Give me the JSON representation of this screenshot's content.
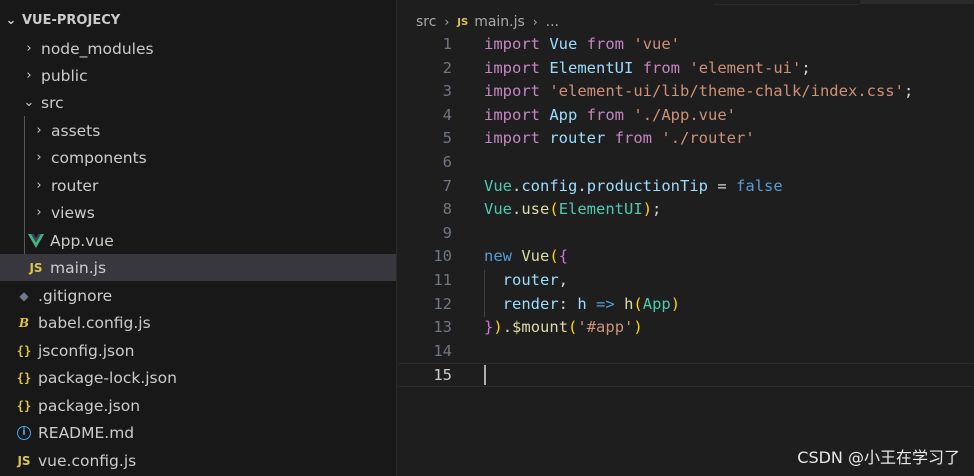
{
  "explorer": {
    "project_name": "VUE-PROJECY",
    "items": [
      {
        "label": "node_modules",
        "kind": "folder",
        "expanded": false
      },
      {
        "label": "public",
        "kind": "folder",
        "expanded": false
      },
      {
        "label": "src",
        "kind": "folder",
        "expanded": true
      },
      {
        "label": "assets",
        "kind": "folder",
        "expanded": false
      },
      {
        "label": "components",
        "kind": "folder",
        "expanded": false
      },
      {
        "label": "router",
        "kind": "folder",
        "expanded": false
      },
      {
        "label": "views",
        "kind": "folder",
        "expanded": false
      },
      {
        "label": "App.vue",
        "kind": "vue-file"
      },
      {
        "label": "main.js",
        "kind": "js-file",
        "selected": true
      },
      {
        "label": ".gitignore",
        "kind": "git-file"
      },
      {
        "label": "babel.config.js",
        "kind": "babel-file"
      },
      {
        "label": "jsconfig.json",
        "kind": "json-file"
      },
      {
        "label": "package-lock.json",
        "kind": "json-file"
      },
      {
        "label": "package.json",
        "kind": "json-file"
      },
      {
        "label": "README.md",
        "kind": "info-file"
      },
      {
        "label": "vue.config.js",
        "kind": "js-file"
      }
    ],
    "icons": {
      "js": "JS",
      "json": "{}"
    }
  },
  "breadcrumb": {
    "folder": "src",
    "file": "main.js",
    "more": "..."
  },
  "editor": {
    "active_line": 15,
    "lines": [
      {
        "n": "1",
        "text": "import Vue from 'vue'"
      },
      {
        "n": "2",
        "text": "import ElementUI from 'element-ui';"
      },
      {
        "n": "3",
        "text": "import 'element-ui/lib/theme-chalk/index.css';"
      },
      {
        "n": "4",
        "text": "import App from './App.vue'"
      },
      {
        "n": "5",
        "text": "import router from './router'"
      },
      {
        "n": "6",
        "text": ""
      },
      {
        "n": "7",
        "text": "Vue.config.productionTip = false"
      },
      {
        "n": "8",
        "text": "Vue.use(ElementUI);"
      },
      {
        "n": "9",
        "text": ""
      },
      {
        "n": "10",
        "text": "new Vue({"
      },
      {
        "n": "11",
        "text": "  router,"
      },
      {
        "n": "12",
        "text": "  render: h => h(App)"
      },
      {
        "n": "13",
        "text": "}).$mount('#app')"
      },
      {
        "n": "14",
        "text": ""
      },
      {
        "n": "15",
        "text": ""
      }
    ]
  },
  "watermark": "CSDN @小王在学习了",
  "colors": {
    "sidebar_bg": "#181818",
    "editor_bg": "#1e1e1e",
    "selected_row": "#37373d",
    "keyword": "#c586c0",
    "string": "#ce9178",
    "variable": "#9cdcfe",
    "class": "#4ec9b0",
    "boolean": "#569cd6",
    "function": "#dcdcaa",
    "vue_green": "#41b883"
  }
}
